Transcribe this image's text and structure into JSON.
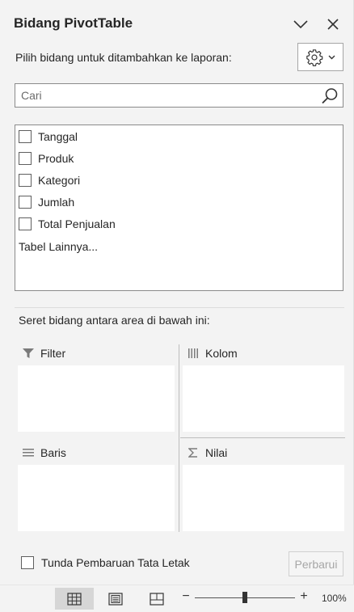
{
  "header": {
    "title": "Bidang PivotTable",
    "subtitle": "Pilih bidang untuk ditambahkan ke laporan:"
  },
  "search": {
    "placeholder": "Cari",
    "value": ""
  },
  "fields": [
    {
      "label": "Tanggal",
      "checked": false
    },
    {
      "label": "Produk",
      "checked": false
    },
    {
      "label": "Kategori",
      "checked": false
    },
    {
      "label": "Jumlah",
      "checked": false
    },
    {
      "label": "Total Penjualan",
      "checked": false
    }
  ],
  "more_tables": "Tabel Lainnya...",
  "drag_hint": "Seret bidang antara area di bawah ini:",
  "areas": {
    "filter": {
      "label": "Filter",
      "icon": "filter-icon"
    },
    "columns": {
      "label": "Kolom",
      "icon": "columns-icon"
    },
    "rows": {
      "label": "Baris",
      "icon": "rows-icon"
    },
    "values": {
      "label": "Nilai",
      "icon": "sigma-icon"
    }
  },
  "footer": {
    "defer_label": "Tunda Pembaruan Tata Letak",
    "defer_checked": false,
    "update_label": "Perbarui"
  },
  "statusbar": {
    "zoom_minus": "−",
    "zoom_plus": "+",
    "zoom": "100%",
    "zoom_level": 100
  }
}
